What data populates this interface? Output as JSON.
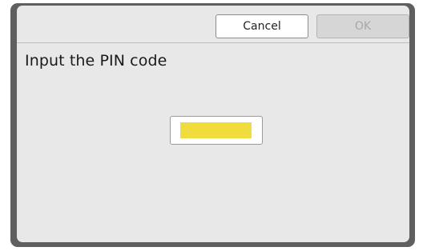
{
  "dialog": {
    "title": "Input the PIN code",
    "cancel_label": "Cancel",
    "ok_label": "OK",
    "ok_enabled": false
  },
  "pin_input": {
    "value": "",
    "highlight_color": "#f0dc3c"
  },
  "colors": {
    "frame": "#5f5f5f",
    "panel": "#e8e8e8",
    "disabled_text": "#a8a8a8"
  }
}
